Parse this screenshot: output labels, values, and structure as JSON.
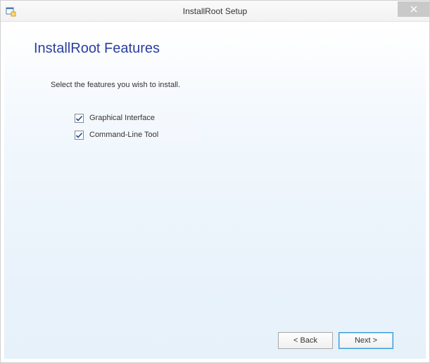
{
  "window": {
    "title": "InstallRoot Setup"
  },
  "page": {
    "heading": "InstallRoot Features",
    "instruction": "Select the features you wish to install."
  },
  "features": [
    {
      "label": "Graphical Interface",
      "checked": true
    },
    {
      "label": "Command-Line Tool",
      "checked": true
    }
  ],
  "buttons": {
    "back": "< Back",
    "next": "Next >"
  }
}
